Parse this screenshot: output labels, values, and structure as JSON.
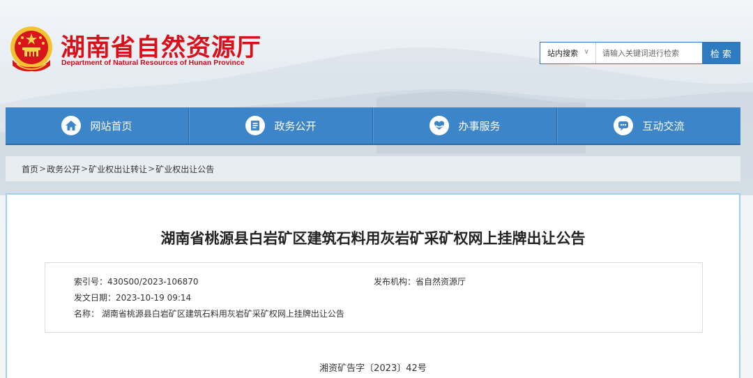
{
  "header": {
    "title": "湖南省自然资源厅",
    "subtitle": "Department of Natural Resources of Hunan Province"
  },
  "search": {
    "scope": "站内搜索",
    "placeholder": "请输入关键词进行检索",
    "button": "检 索"
  },
  "nav": {
    "items": [
      {
        "label": "网站首页",
        "icon": "home-icon"
      },
      {
        "label": "政务公开",
        "icon": "document-icon"
      },
      {
        "label": "办事服务",
        "icon": "service-icon"
      },
      {
        "label": "互动交流",
        "icon": "chat-icon"
      }
    ]
  },
  "breadcrumb": [
    "首页",
    "政务公开",
    "矿业权出让转让",
    "矿业权出让公告"
  ],
  "article": {
    "title": "湖南省桃源县白岩矿区建筑石料用灰岩矿采矿权网上挂牌出让公告",
    "meta": {
      "index_label": "索引号：",
      "index_value": "430S00/2023-106870",
      "publisher_label": "发布机构：",
      "publisher_value": "省自然资源厅",
      "date_label": "发文日期：",
      "date_value": "2023-10-19 09:14",
      "name_label": "名称：",
      "name_value": "湖南省桃源县白岩矿区建筑石料用灰岩矿采矿权网上挂牌出让公告"
    },
    "doc_number": "湘资矿告字〔2023〕42号"
  },
  "colors": {
    "brand_red": "#d9101a",
    "nav_blue": "#3b85c8",
    "panel_border": "#9fd0f2"
  }
}
